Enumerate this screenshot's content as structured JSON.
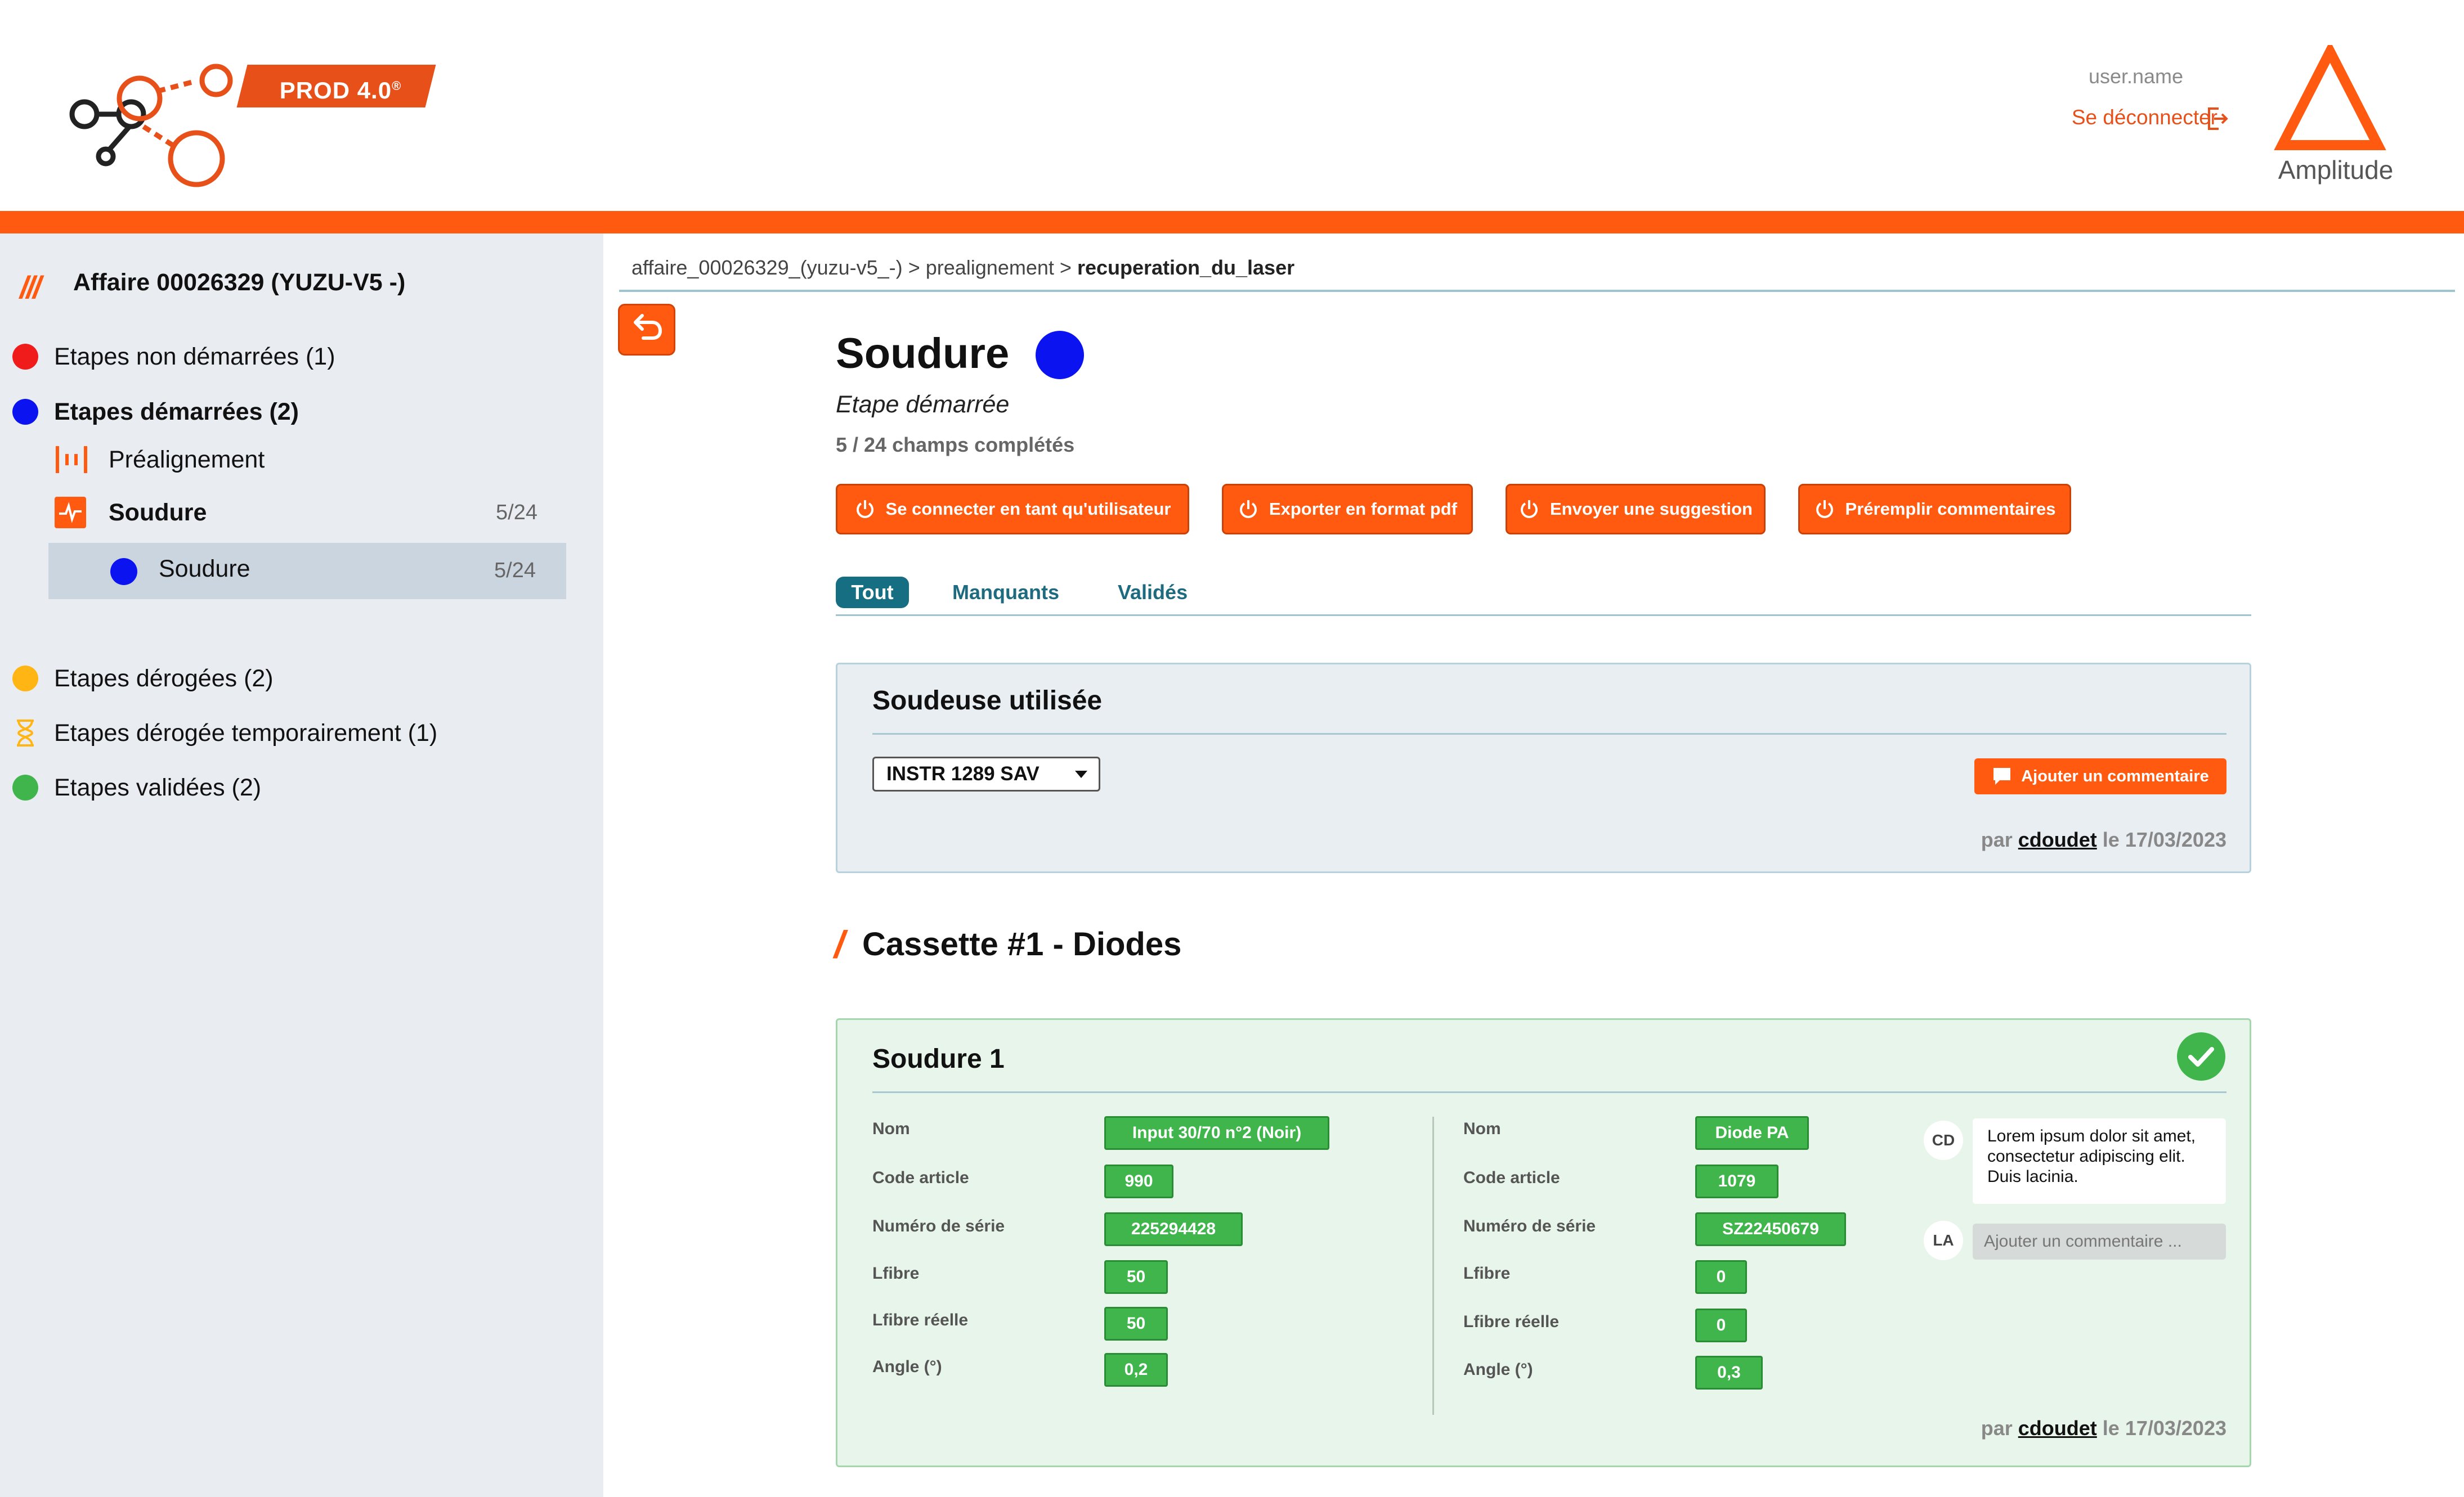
{
  "header": {
    "badge": "PROD 4.0",
    "badge_mark": "®",
    "username": "user.name",
    "logout_label": "Se déconnecter",
    "brand": "Amplitude"
  },
  "colors": {
    "accent": "#FF5A0F",
    "started": "#0B14F0",
    "not_started": "#F01B1B",
    "derogated": "#FFB514",
    "validated": "#3FB54C",
    "tab_active": "#156E82"
  },
  "sidebar": {
    "affaire_slashes": "///",
    "affaire_title": "Affaire 00026329 (YUZU-V5 -)",
    "statuses": [
      {
        "label": "Etapes non démarrées (1)",
        "icon": "red-dot-icon"
      },
      {
        "label": "Etapes démarrées (2)",
        "icon": "blue-dot-icon"
      },
      {
        "label": "Etapes dérogées (2)",
        "icon": "yellow-dot-icon"
      },
      {
        "label": "Etapes dérogée temporairement (1)",
        "icon": "hourglass-icon"
      },
      {
        "label": "Etapes validées (2)",
        "icon": "green-dot-icon"
      }
    ],
    "steps": [
      {
        "label": "Préalignement",
        "count": "",
        "icon": "prealignment-icon"
      },
      {
        "label": "Soudure",
        "count": "5/24",
        "icon": "welding-icon"
      }
    ],
    "sub_step": {
      "label": "Soudure",
      "count": "5/24"
    }
  },
  "breadcrumb": {
    "part1": "affaire_00026329_(yuzu-v5_-)",
    "sep": ">",
    "part2": "prealignement",
    "part3": "recuperation_du_laser"
  },
  "page": {
    "title": "Soudure",
    "subtitle": "Etape démarrée",
    "progress": "5 / 24 champs complétés"
  },
  "actions": [
    "Se connecter en tant qu'utilisateur",
    "Exporter en format pdf",
    "Envoyer une suggestion",
    "Préremplir commentaires"
  ],
  "tabs": [
    "Tout",
    "Manquants",
    "Validés"
  ],
  "soudeuse": {
    "title": "Soudeuse utilisée",
    "selected": "INSTR 1289 SAV",
    "add_comment": "Ajouter un commentaire",
    "by_prefix": "par",
    "user": "cdoudet",
    "date": "le 17/03/2023"
  },
  "section": {
    "slash": "/",
    "title": "Cassette #1 - Diodes"
  },
  "soudure1": {
    "title": "Soudure 1",
    "left": [
      {
        "label": "Nom",
        "value": "Input 30/70 n°2 (Noir)"
      },
      {
        "label": "Code article",
        "value": "990"
      },
      {
        "label": "Numéro de série",
        "value": "225294428"
      },
      {
        "label": "Lfibre",
        "value": "50"
      },
      {
        "label": "Lfibre réelle",
        "value": "50"
      },
      {
        "label": "Angle (°)",
        "value": "0,2"
      }
    ],
    "right": [
      {
        "label": "Nom",
        "value": "Diode PA"
      },
      {
        "label": "Code article",
        "value": "1079"
      },
      {
        "label": "Numéro de série",
        "value": "SZ22450679"
      },
      {
        "label": "Lfibre",
        "value": "0"
      },
      {
        "label": "Lfibre réelle",
        "value": "0"
      },
      {
        "label": "Angle (°)",
        "value": "0,3"
      }
    ],
    "comment_author": "CD",
    "comment_text": "Lorem ipsum dolor sit amet, consectetur adipiscing elit. Duis lacinia.",
    "input_author": "LA",
    "input_placeholder": "Ajouter un commentaire ...",
    "by_prefix": "par",
    "user": "cdoudet",
    "date": "le 17/03/2023"
  }
}
